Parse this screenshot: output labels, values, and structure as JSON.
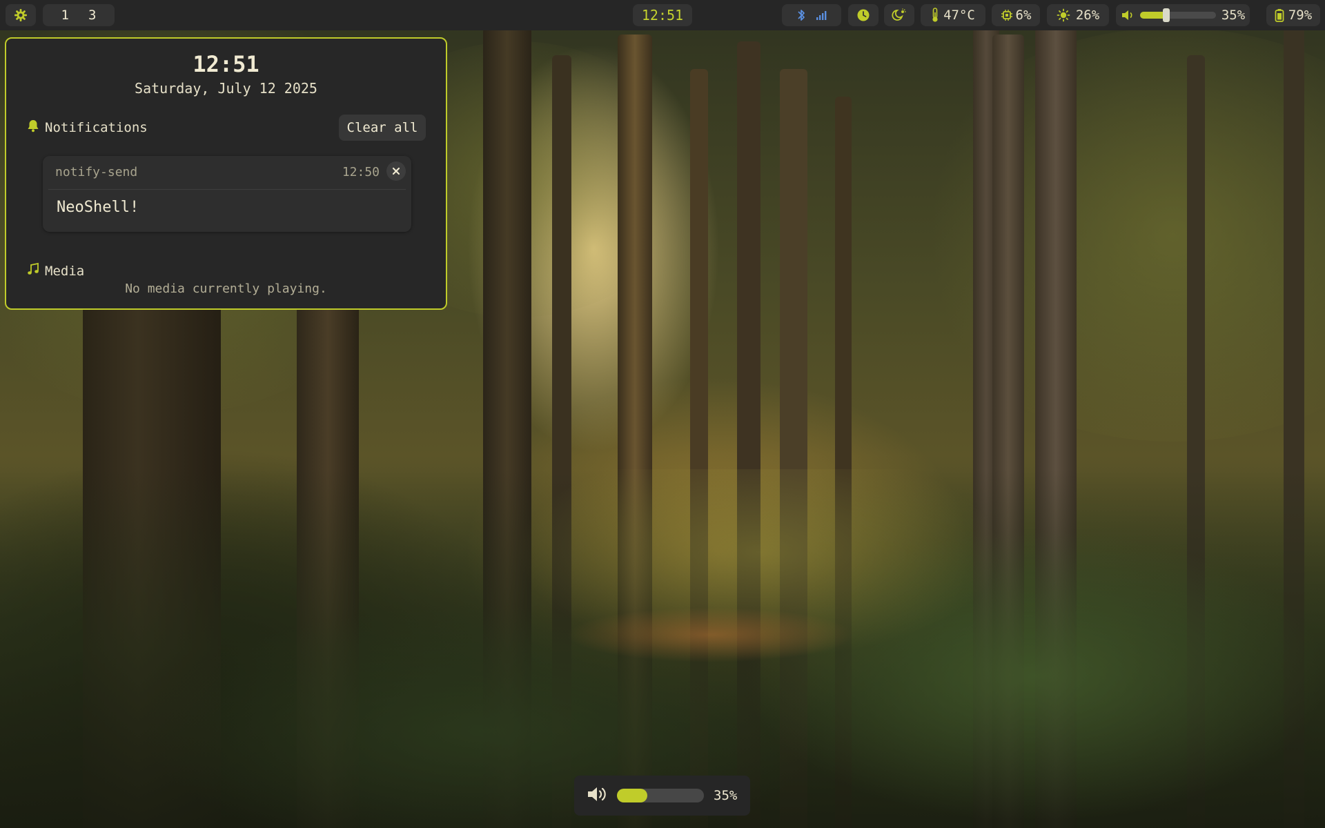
{
  "theme": {
    "accent": "#c0cc2a",
    "bar_bg": "#262626",
    "pill_bg": "#333333",
    "panel_bg": "#272727"
  },
  "topbar": {
    "launcher_icon": "gear-icon",
    "workspaces": [
      "1",
      "3"
    ],
    "clock": "12:51",
    "connectivity_icons": [
      "bluetooth-icon",
      "signal-bars-icon"
    ],
    "clock_icon": "clock-icon",
    "night_light_icon": "sun-moon-icon",
    "temperature": "47°C",
    "cpu": "6%",
    "brightness": "26%",
    "volume": "35%",
    "volume_level": 0.35,
    "battery": "79%"
  },
  "panel": {
    "time": "12:51",
    "date": "Saturday, July 12 2025",
    "notifications": {
      "title": "Notifications",
      "clear_label": "Clear all",
      "items": [
        {
          "app": "notify-send",
          "time": "12:50",
          "body": "NeoShell!"
        }
      ]
    },
    "media": {
      "title": "Media",
      "empty_text": "No media currently playing."
    }
  },
  "osd": {
    "icon": "speaker-icon",
    "value": "35%",
    "level": 0.35
  }
}
